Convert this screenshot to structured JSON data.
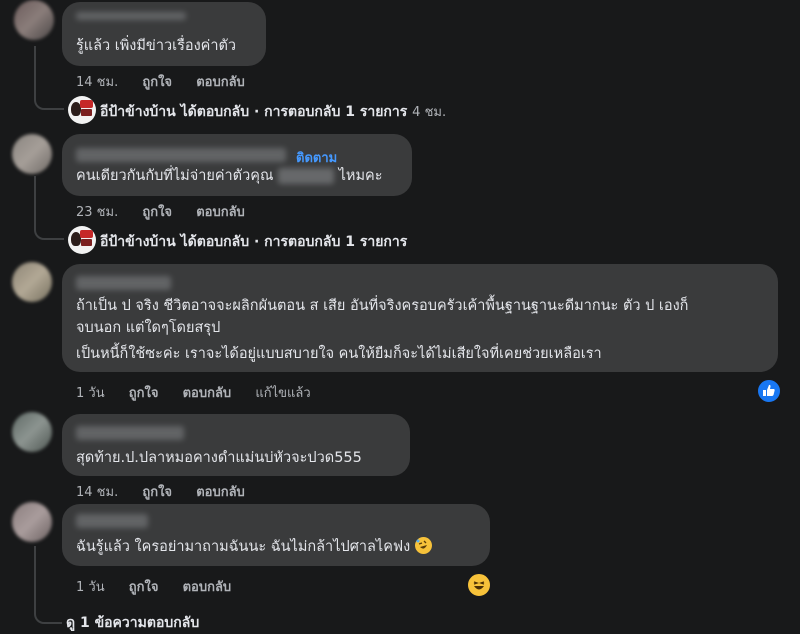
{
  "comments": [
    {
      "text": "รู้แล้ว เพิ่งมีข่าวเรื่องค่าตัว",
      "meta": {
        "time": "14 ชม.",
        "like": "ถูกใจ",
        "reply": "ตอบกลับ"
      },
      "replies": {
        "author": "อีป้าข้างบ้าน",
        "replied": "ได้ตอบกลับ",
        "sep": "·",
        "count": "การตอบกลับ 1 รายการ",
        "time": "4 ชม."
      }
    },
    {
      "follow": "ติดตาม",
      "text_before": "คนเดียวกันกับที่ไม่จ่ายค่าตัวคุณ",
      "text_after": "ไหมคะ",
      "meta": {
        "time": "23 ชม.",
        "like": "ถูกใจ",
        "reply": "ตอบกลับ"
      },
      "replies": {
        "author": "อีป้าข้างบ้าน",
        "replied": "ได้ตอบกลับ",
        "sep": "·",
        "count": "การตอบกลับ 1 รายการ"
      }
    },
    {
      "lines": [
        "ถ้าเป็น ป จริง ชีวิตอาจจะผลิกผันตอน ส เสีย อันที่จริงครอบครัวเค้าพื้นฐานฐานะดีมากนะ ตัว ป เองก็",
        "จบนอก แต่ใดๆโดยสรุป",
        "เป็นหนี้ก็ใช้ซะค่ะ เราจะได้อยู่แบบสบายใจ คนให้ยืมก็จะได้ไม่เสียใจที่เคยช่วยเหลือเรา"
      ],
      "meta": {
        "time": "1 วัน",
        "like": "ถูกใจ",
        "reply": "ตอบกลับ",
        "edited": "แก้ไขแล้ว"
      },
      "reaction_icon": "like-icon"
    },
    {
      "text": "สุดท้าย.ป.ปลาหมอคางดำแม่นบ่หัวจะปวด555",
      "meta": {
        "time": "14 ชม.",
        "like": "ถูกใจ",
        "reply": "ตอบกลับ"
      }
    },
    {
      "text": "ฉันรู้แล้ว ใครอย่ามาถามฉันนะ ฉันไม่กล้าไปศาลไคฟง",
      "emoji": "rofl-emoji",
      "meta": {
        "time": "1 วัน",
        "like": "ถูกใจ",
        "reply": "ตอบกลับ"
      },
      "reaction_icon": "haha-icon",
      "view_replies": "ดู 1 ข้อความตอบกลับ"
    }
  ],
  "colors": {
    "background": "#18191a",
    "bubble": "#3a3b3c",
    "link": "#4599ff",
    "like": "#1877f2"
  }
}
